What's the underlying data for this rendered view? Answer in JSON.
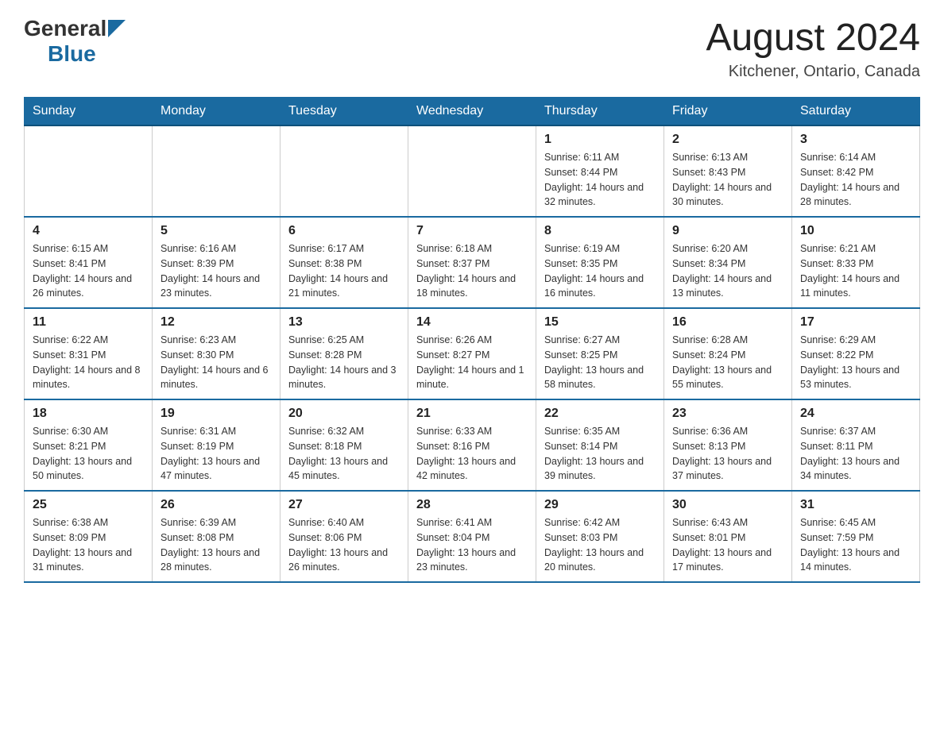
{
  "header": {
    "logo_general": "General",
    "logo_blue": "Blue",
    "month_title": "August 2024",
    "location": "Kitchener, Ontario, Canada"
  },
  "days_of_week": [
    "Sunday",
    "Monday",
    "Tuesday",
    "Wednesday",
    "Thursday",
    "Friday",
    "Saturday"
  ],
  "weeks": [
    [
      {
        "day": "",
        "info": ""
      },
      {
        "day": "",
        "info": ""
      },
      {
        "day": "",
        "info": ""
      },
      {
        "day": "",
        "info": ""
      },
      {
        "day": "1",
        "info": "Sunrise: 6:11 AM\nSunset: 8:44 PM\nDaylight: 14 hours and 32 minutes."
      },
      {
        "day": "2",
        "info": "Sunrise: 6:13 AM\nSunset: 8:43 PM\nDaylight: 14 hours and 30 minutes."
      },
      {
        "day": "3",
        "info": "Sunrise: 6:14 AM\nSunset: 8:42 PM\nDaylight: 14 hours and 28 minutes."
      }
    ],
    [
      {
        "day": "4",
        "info": "Sunrise: 6:15 AM\nSunset: 8:41 PM\nDaylight: 14 hours and 26 minutes."
      },
      {
        "day": "5",
        "info": "Sunrise: 6:16 AM\nSunset: 8:39 PM\nDaylight: 14 hours and 23 minutes."
      },
      {
        "day": "6",
        "info": "Sunrise: 6:17 AM\nSunset: 8:38 PM\nDaylight: 14 hours and 21 minutes."
      },
      {
        "day": "7",
        "info": "Sunrise: 6:18 AM\nSunset: 8:37 PM\nDaylight: 14 hours and 18 minutes."
      },
      {
        "day": "8",
        "info": "Sunrise: 6:19 AM\nSunset: 8:35 PM\nDaylight: 14 hours and 16 minutes."
      },
      {
        "day": "9",
        "info": "Sunrise: 6:20 AM\nSunset: 8:34 PM\nDaylight: 14 hours and 13 minutes."
      },
      {
        "day": "10",
        "info": "Sunrise: 6:21 AM\nSunset: 8:33 PM\nDaylight: 14 hours and 11 minutes."
      }
    ],
    [
      {
        "day": "11",
        "info": "Sunrise: 6:22 AM\nSunset: 8:31 PM\nDaylight: 14 hours and 8 minutes."
      },
      {
        "day": "12",
        "info": "Sunrise: 6:23 AM\nSunset: 8:30 PM\nDaylight: 14 hours and 6 minutes."
      },
      {
        "day": "13",
        "info": "Sunrise: 6:25 AM\nSunset: 8:28 PM\nDaylight: 14 hours and 3 minutes."
      },
      {
        "day": "14",
        "info": "Sunrise: 6:26 AM\nSunset: 8:27 PM\nDaylight: 14 hours and 1 minute."
      },
      {
        "day": "15",
        "info": "Sunrise: 6:27 AM\nSunset: 8:25 PM\nDaylight: 13 hours and 58 minutes."
      },
      {
        "day": "16",
        "info": "Sunrise: 6:28 AM\nSunset: 8:24 PM\nDaylight: 13 hours and 55 minutes."
      },
      {
        "day": "17",
        "info": "Sunrise: 6:29 AM\nSunset: 8:22 PM\nDaylight: 13 hours and 53 minutes."
      }
    ],
    [
      {
        "day": "18",
        "info": "Sunrise: 6:30 AM\nSunset: 8:21 PM\nDaylight: 13 hours and 50 minutes."
      },
      {
        "day": "19",
        "info": "Sunrise: 6:31 AM\nSunset: 8:19 PM\nDaylight: 13 hours and 47 minutes."
      },
      {
        "day": "20",
        "info": "Sunrise: 6:32 AM\nSunset: 8:18 PM\nDaylight: 13 hours and 45 minutes."
      },
      {
        "day": "21",
        "info": "Sunrise: 6:33 AM\nSunset: 8:16 PM\nDaylight: 13 hours and 42 minutes."
      },
      {
        "day": "22",
        "info": "Sunrise: 6:35 AM\nSunset: 8:14 PM\nDaylight: 13 hours and 39 minutes."
      },
      {
        "day": "23",
        "info": "Sunrise: 6:36 AM\nSunset: 8:13 PM\nDaylight: 13 hours and 37 minutes."
      },
      {
        "day": "24",
        "info": "Sunrise: 6:37 AM\nSunset: 8:11 PM\nDaylight: 13 hours and 34 minutes."
      }
    ],
    [
      {
        "day": "25",
        "info": "Sunrise: 6:38 AM\nSunset: 8:09 PM\nDaylight: 13 hours and 31 minutes."
      },
      {
        "day": "26",
        "info": "Sunrise: 6:39 AM\nSunset: 8:08 PM\nDaylight: 13 hours and 28 minutes."
      },
      {
        "day": "27",
        "info": "Sunrise: 6:40 AM\nSunset: 8:06 PM\nDaylight: 13 hours and 26 minutes."
      },
      {
        "day": "28",
        "info": "Sunrise: 6:41 AM\nSunset: 8:04 PM\nDaylight: 13 hours and 23 minutes."
      },
      {
        "day": "29",
        "info": "Sunrise: 6:42 AM\nSunset: 8:03 PM\nDaylight: 13 hours and 20 minutes."
      },
      {
        "day": "30",
        "info": "Sunrise: 6:43 AM\nSunset: 8:01 PM\nDaylight: 13 hours and 17 minutes."
      },
      {
        "day": "31",
        "info": "Sunrise: 6:45 AM\nSunset: 7:59 PM\nDaylight: 13 hours and 14 minutes."
      }
    ]
  ]
}
